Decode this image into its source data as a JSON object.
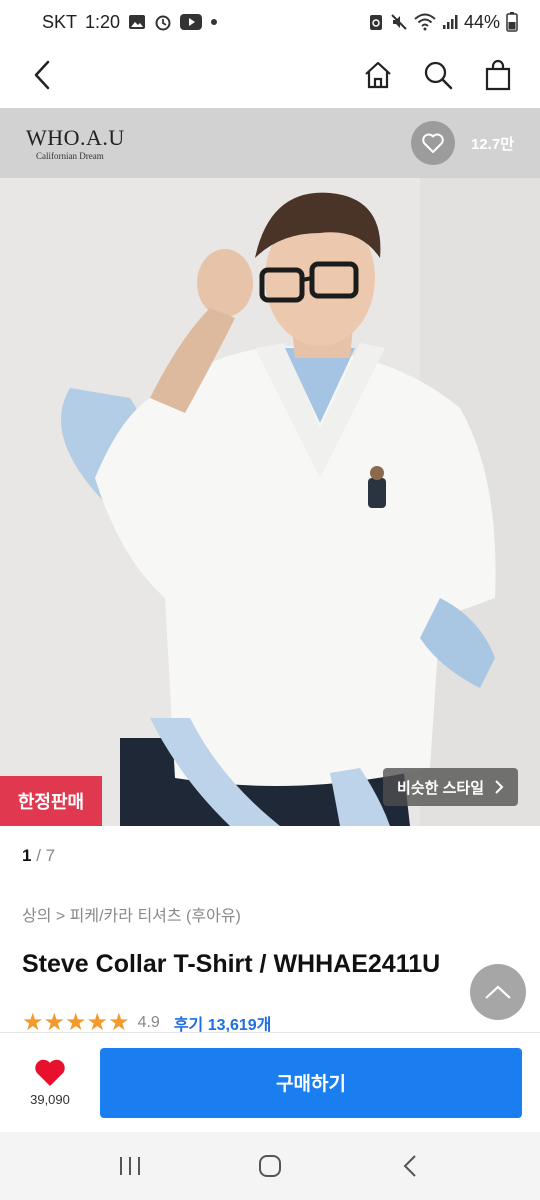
{
  "status_bar": {
    "carrier": "SKT",
    "time": "1:20",
    "battery": "44%",
    "icons_left": [
      "gallery-icon",
      "alarm-icon",
      "youtube-icon",
      "dot-icon"
    ],
    "icons_right": [
      "recycle-icon",
      "mute-icon",
      "wifi-icon",
      "signal-icon",
      "battery-icon"
    ]
  },
  "header": {
    "back": "back-icon",
    "actions": [
      "home-icon",
      "search-icon",
      "cart-icon"
    ]
  },
  "brand": {
    "name": "WHO.A.U",
    "tagline": "Californian Dream",
    "like_count": "12.7만"
  },
  "hero": {
    "limited_badge": "한정판매",
    "similar_style": "비슷한 스타일",
    "page_current": "1",
    "page_sep": " / ",
    "page_total": "7"
  },
  "product": {
    "breadcrumb": "상의 > 피케/카라 티셔츠 (후아유)",
    "title": "Steve Collar T-Shirt / WHHAE2411U",
    "stars": "★★★★★",
    "rating": "4.9",
    "reviews": "후기 13,619개"
  },
  "buy_bar": {
    "wish_count": "39,090",
    "buy_label": "구매하기"
  },
  "colors": {
    "accent": "#1a7ef0",
    "badge": "#e0394f",
    "star": "#f39a2d",
    "heart": "#e8102c"
  }
}
